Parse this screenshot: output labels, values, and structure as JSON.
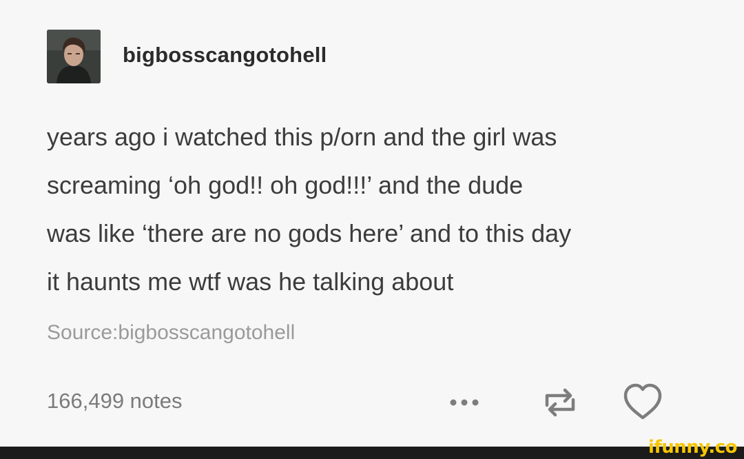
{
  "post": {
    "username": "bigbosscangotohell",
    "body_lines": [
      "years ago i watched this p/orn and the girl was",
      "screaming ‘oh god!! oh god!!!’ and the dude",
      "was like ‘there are no gods here’ and to this day",
      "it haunts me wtf was he talking about"
    ],
    "source": "Source:bigbosscangotohell",
    "notes": "166,499 notes"
  },
  "actions": {
    "more_icon": "more-dots-icon",
    "reblog_icon": "reblog-icon",
    "like_icon": "heart-icon"
  },
  "watermark": {
    "text": "ifunny.co",
    "color": "#f7c600"
  },
  "colors": {
    "background": "#f7f7f7",
    "text": "#3c3c3c",
    "muted": "#9a9a9a"
  }
}
